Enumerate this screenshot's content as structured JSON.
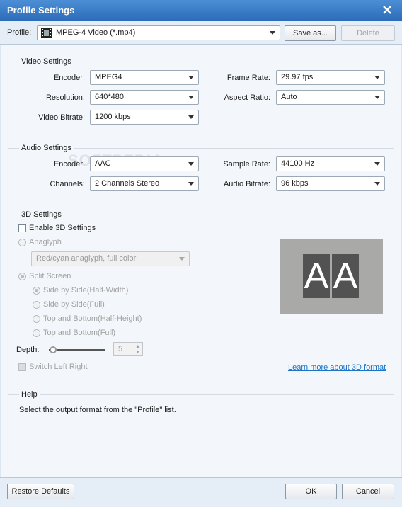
{
  "window": {
    "title": "Profile Settings"
  },
  "profile": {
    "label": "Profile:",
    "value": "MPEG-4 Video (*.mp4)",
    "save_as": "Save as...",
    "delete": "Delete"
  },
  "video": {
    "section": "Video Settings",
    "encoder_label": "Encoder:",
    "encoder": "MPEG4",
    "resolution_label": "Resolution:",
    "resolution": "640*480",
    "bitrate_label": "Video Bitrate:",
    "bitrate": "1200 kbps",
    "framerate_label": "Frame Rate:",
    "framerate": "29.97 fps",
    "aspect_label": "Aspect Ratio:",
    "aspect": "Auto"
  },
  "audio": {
    "section": "Audio Settings",
    "encoder_label": "Encoder:",
    "encoder": "AAC",
    "channels_label": "Channels:",
    "channels": "2 Channels Stereo",
    "samplerate_label": "Sample Rate:",
    "samplerate": "44100 Hz",
    "bitrate_label": "Audio Bitrate:",
    "bitrate": "96 kbps"
  },
  "settings3d": {
    "section": "3D Settings",
    "enable": "Enable 3D Settings",
    "anaglyph": "Anaglyph",
    "anaglyph_mode": "Red/cyan anaglyph, full color",
    "split_screen": "Split Screen",
    "options": [
      "Side by Side(Half-Width)",
      "Side by Side(Full)",
      "Top and Bottom(Half-Height)",
      "Top and Bottom(Full)"
    ],
    "depth_label": "Depth:",
    "depth_value": "5",
    "switch": "Switch Left Right",
    "learn_more": "Learn more about 3D format",
    "preview_left": "A",
    "preview_right": "A"
  },
  "help": {
    "section": "Help",
    "text": "Select the output format from the \"Profile\" list."
  },
  "footer": {
    "restore": "Restore Defaults",
    "ok": "OK",
    "cancel": "Cancel"
  },
  "watermark": "SOFTPEDIA"
}
